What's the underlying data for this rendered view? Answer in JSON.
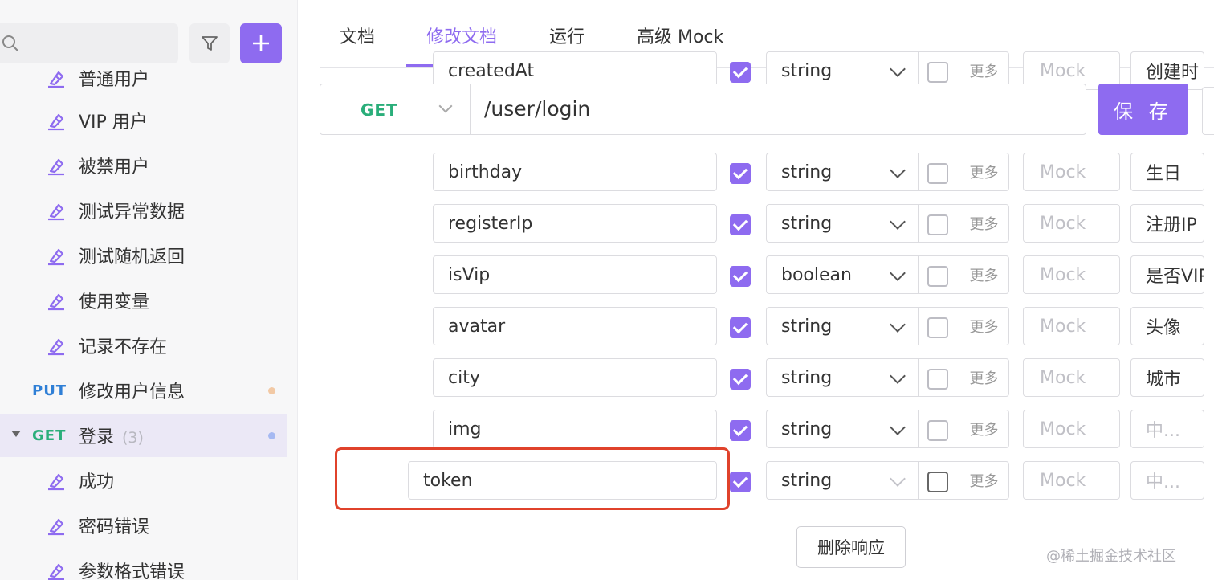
{
  "sidebar": {
    "items": [
      {
        "label": "普通用户",
        "type": "case"
      },
      {
        "label": "VIP 用户",
        "type": "case"
      },
      {
        "label": "被禁用户",
        "type": "case"
      },
      {
        "label": "测试异常数据",
        "type": "case"
      },
      {
        "label": "测试随机返回",
        "type": "case"
      },
      {
        "label": "使用变量",
        "type": "case"
      },
      {
        "label": "记录不存在",
        "type": "case"
      },
      {
        "label": "修改用户信息",
        "type": "api",
        "method": "PUT",
        "dot_color": "#f2c9a5"
      },
      {
        "label": "登录",
        "type": "api",
        "method": "GET",
        "count": "(3)",
        "dot_color": "#a6b9f2",
        "active": true
      },
      {
        "label": "成功",
        "type": "case"
      },
      {
        "label": "密码错误",
        "type": "case"
      },
      {
        "label": "参数格式错误",
        "type": "case"
      }
    ],
    "accent_color": "#8e6bf0"
  },
  "tabs": [
    {
      "label": "文档",
      "active": false
    },
    {
      "label": "修改文档",
      "active": true
    },
    {
      "label": "运行",
      "active": false
    },
    {
      "label": "高级 Mock",
      "active": false
    }
  ],
  "request": {
    "method": "GET",
    "path": "/user/login",
    "save_label": "保 存"
  },
  "fields": [
    {
      "name": "createdAt",
      "type": "string",
      "required": true,
      "more": "更多",
      "mock": "Mock",
      "desc": "创建时",
      "desc_placeholder": false
    },
    {
      "name": "birthday",
      "type": "string",
      "required": true,
      "more": "更多",
      "mock": "Mock",
      "desc": "生日",
      "desc_placeholder": false
    },
    {
      "name": "registerIp",
      "type": "string",
      "required": true,
      "more": "更多",
      "mock": "Mock",
      "desc": "注册IP",
      "desc_placeholder": false
    },
    {
      "name": "isVip",
      "type": "boolean",
      "required": true,
      "more": "更多",
      "mock": "Mock",
      "desc": "是否VIP",
      "desc_placeholder": false
    },
    {
      "name": "avatar",
      "type": "string",
      "required": true,
      "more": "更多",
      "mock": "Mock",
      "desc": "头像",
      "desc_placeholder": false
    },
    {
      "name": "city",
      "type": "string",
      "required": true,
      "more": "更多",
      "mock": "Mock",
      "desc": "城市",
      "desc_placeholder": false
    },
    {
      "name": "img",
      "type": "string",
      "required": true,
      "more": "更多",
      "mock": "Mock",
      "desc": "中...",
      "desc_placeholder": true
    },
    {
      "name": "token",
      "type": "string",
      "required": true,
      "more": "更多",
      "mock": "Mock",
      "desc": "中...",
      "desc_placeholder": true
    }
  ],
  "delete_label": "删除响应",
  "watermark": "@稀土掘金技术社区"
}
